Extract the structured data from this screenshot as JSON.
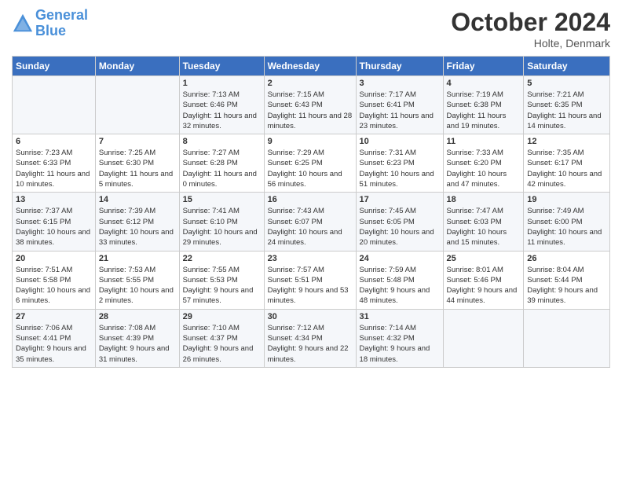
{
  "header": {
    "logo_line1": "General",
    "logo_line2": "Blue",
    "month": "October 2024",
    "location": "Holte, Denmark"
  },
  "days_of_week": [
    "Sunday",
    "Monday",
    "Tuesday",
    "Wednesday",
    "Thursday",
    "Friday",
    "Saturday"
  ],
  "weeks": [
    [
      {
        "day": "",
        "info": ""
      },
      {
        "day": "",
        "info": ""
      },
      {
        "day": "1",
        "sunrise": "Sunrise: 7:13 AM",
        "sunset": "Sunset: 6:46 PM",
        "daylight": "Daylight: 11 hours and 32 minutes."
      },
      {
        "day": "2",
        "sunrise": "Sunrise: 7:15 AM",
        "sunset": "Sunset: 6:43 PM",
        "daylight": "Daylight: 11 hours and 28 minutes."
      },
      {
        "day": "3",
        "sunrise": "Sunrise: 7:17 AM",
        "sunset": "Sunset: 6:41 PM",
        "daylight": "Daylight: 11 hours and 23 minutes."
      },
      {
        "day": "4",
        "sunrise": "Sunrise: 7:19 AM",
        "sunset": "Sunset: 6:38 PM",
        "daylight": "Daylight: 11 hours and 19 minutes."
      },
      {
        "day": "5",
        "sunrise": "Sunrise: 7:21 AM",
        "sunset": "Sunset: 6:35 PM",
        "daylight": "Daylight: 11 hours and 14 minutes."
      }
    ],
    [
      {
        "day": "6",
        "sunrise": "Sunrise: 7:23 AM",
        "sunset": "Sunset: 6:33 PM",
        "daylight": "Daylight: 11 hours and 10 minutes."
      },
      {
        "day": "7",
        "sunrise": "Sunrise: 7:25 AM",
        "sunset": "Sunset: 6:30 PM",
        "daylight": "Daylight: 11 hours and 5 minutes."
      },
      {
        "day": "8",
        "sunrise": "Sunrise: 7:27 AM",
        "sunset": "Sunset: 6:28 PM",
        "daylight": "Daylight: 11 hours and 0 minutes."
      },
      {
        "day": "9",
        "sunrise": "Sunrise: 7:29 AM",
        "sunset": "Sunset: 6:25 PM",
        "daylight": "Daylight: 10 hours and 56 minutes."
      },
      {
        "day": "10",
        "sunrise": "Sunrise: 7:31 AM",
        "sunset": "Sunset: 6:23 PM",
        "daylight": "Daylight: 10 hours and 51 minutes."
      },
      {
        "day": "11",
        "sunrise": "Sunrise: 7:33 AM",
        "sunset": "Sunset: 6:20 PM",
        "daylight": "Daylight: 10 hours and 47 minutes."
      },
      {
        "day": "12",
        "sunrise": "Sunrise: 7:35 AM",
        "sunset": "Sunset: 6:17 PM",
        "daylight": "Daylight: 10 hours and 42 minutes."
      }
    ],
    [
      {
        "day": "13",
        "sunrise": "Sunrise: 7:37 AM",
        "sunset": "Sunset: 6:15 PM",
        "daylight": "Daylight: 10 hours and 38 minutes."
      },
      {
        "day": "14",
        "sunrise": "Sunrise: 7:39 AM",
        "sunset": "Sunset: 6:12 PM",
        "daylight": "Daylight: 10 hours and 33 minutes."
      },
      {
        "day": "15",
        "sunrise": "Sunrise: 7:41 AM",
        "sunset": "Sunset: 6:10 PM",
        "daylight": "Daylight: 10 hours and 29 minutes."
      },
      {
        "day": "16",
        "sunrise": "Sunrise: 7:43 AM",
        "sunset": "Sunset: 6:07 PM",
        "daylight": "Daylight: 10 hours and 24 minutes."
      },
      {
        "day": "17",
        "sunrise": "Sunrise: 7:45 AM",
        "sunset": "Sunset: 6:05 PM",
        "daylight": "Daylight: 10 hours and 20 minutes."
      },
      {
        "day": "18",
        "sunrise": "Sunrise: 7:47 AM",
        "sunset": "Sunset: 6:03 PM",
        "daylight": "Daylight: 10 hours and 15 minutes."
      },
      {
        "day": "19",
        "sunrise": "Sunrise: 7:49 AM",
        "sunset": "Sunset: 6:00 PM",
        "daylight": "Daylight: 10 hours and 11 minutes."
      }
    ],
    [
      {
        "day": "20",
        "sunrise": "Sunrise: 7:51 AM",
        "sunset": "Sunset: 5:58 PM",
        "daylight": "Daylight: 10 hours and 6 minutes."
      },
      {
        "day": "21",
        "sunrise": "Sunrise: 7:53 AM",
        "sunset": "Sunset: 5:55 PM",
        "daylight": "Daylight: 10 hours and 2 minutes."
      },
      {
        "day": "22",
        "sunrise": "Sunrise: 7:55 AM",
        "sunset": "Sunset: 5:53 PM",
        "daylight": "Daylight: 9 hours and 57 minutes."
      },
      {
        "day": "23",
        "sunrise": "Sunrise: 7:57 AM",
        "sunset": "Sunset: 5:51 PM",
        "daylight": "Daylight: 9 hours and 53 minutes."
      },
      {
        "day": "24",
        "sunrise": "Sunrise: 7:59 AM",
        "sunset": "Sunset: 5:48 PM",
        "daylight": "Daylight: 9 hours and 48 minutes."
      },
      {
        "day": "25",
        "sunrise": "Sunrise: 8:01 AM",
        "sunset": "Sunset: 5:46 PM",
        "daylight": "Daylight: 9 hours and 44 minutes."
      },
      {
        "day": "26",
        "sunrise": "Sunrise: 8:04 AM",
        "sunset": "Sunset: 5:44 PM",
        "daylight": "Daylight: 9 hours and 39 minutes."
      }
    ],
    [
      {
        "day": "27",
        "sunrise": "Sunrise: 7:06 AM",
        "sunset": "Sunset: 4:41 PM",
        "daylight": "Daylight: 9 hours and 35 minutes."
      },
      {
        "day": "28",
        "sunrise": "Sunrise: 7:08 AM",
        "sunset": "Sunset: 4:39 PM",
        "daylight": "Daylight: 9 hours and 31 minutes."
      },
      {
        "day": "29",
        "sunrise": "Sunrise: 7:10 AM",
        "sunset": "Sunset: 4:37 PM",
        "daylight": "Daylight: 9 hours and 26 minutes."
      },
      {
        "day": "30",
        "sunrise": "Sunrise: 7:12 AM",
        "sunset": "Sunset: 4:34 PM",
        "daylight": "Daylight: 9 hours and 22 minutes."
      },
      {
        "day": "31",
        "sunrise": "Sunrise: 7:14 AM",
        "sunset": "Sunset: 4:32 PM",
        "daylight": "Daylight: 9 hours and 18 minutes."
      },
      {
        "day": "",
        "info": ""
      },
      {
        "day": "",
        "info": ""
      }
    ]
  ]
}
